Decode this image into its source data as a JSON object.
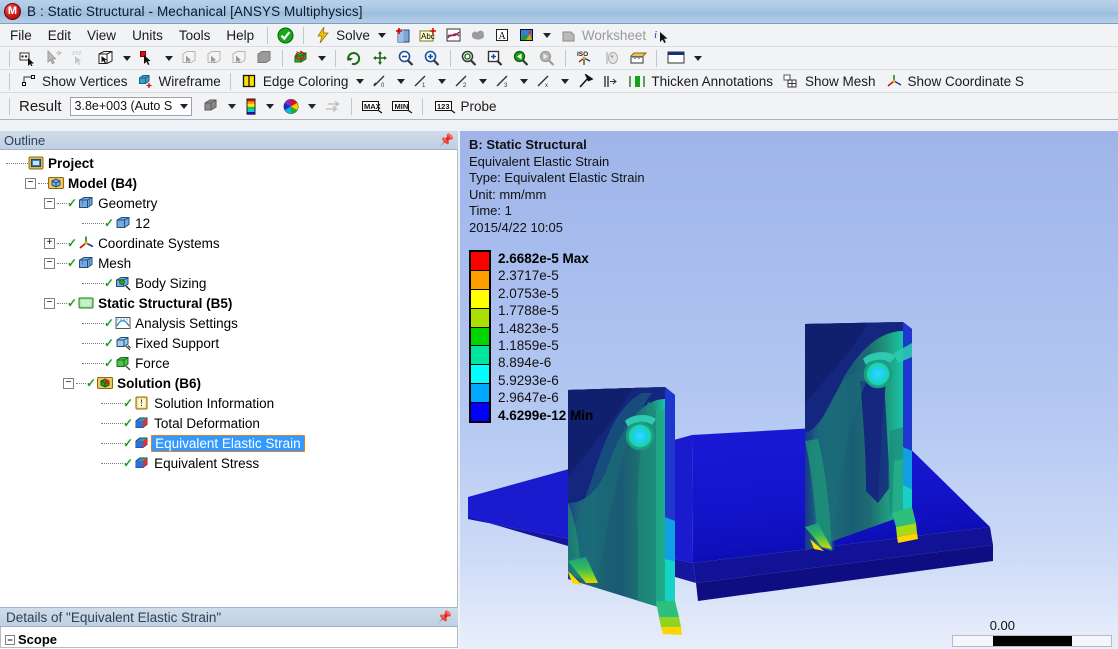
{
  "window": {
    "title": "B : Static Structural - Mechanical [ANSYS Multiphysics]",
    "logo_letter": "M"
  },
  "menubar": {
    "items": [
      "File",
      "Edit",
      "View",
      "Units",
      "Tools",
      "Help"
    ],
    "solve_label": "Solve",
    "worksheet_label": "Worksheet",
    "icons": [
      "green-check-icon",
      "lightning-solve-icon",
      "new-chart-icon",
      "abc-label-icon",
      "chart-curve-icon",
      "cloud-icon",
      "annotation-a-icon",
      "image-capture-icon",
      "worksheet-icon",
      "info-cursor-icon"
    ]
  },
  "toolbar_selection": {
    "icons": [
      "select-cursor-icon",
      "pointer-arrow-icon",
      "xyz-axis-icon",
      "box-select-icon",
      "cursor-red-icon",
      "vertex-select-icon",
      "edge-select-icon",
      "face-select-icon",
      "body-select-icon",
      "body-color-icon",
      "rotate-icon",
      "pan-icon",
      "zoom-out-icon",
      "zoom-in-icon",
      "zoom-to-fit-icon",
      "box-zoom-icon",
      "previous-view-icon",
      "next-view-icon",
      "iso-view-icon",
      "look-at-icon",
      "ruler-icon",
      "viewport-layout-icon"
    ]
  },
  "toolbar_display": {
    "show_vertices": "Show Vertices",
    "wireframe": "Wireframe",
    "edge_coloring": "Edge Coloring",
    "thicken_annotations": "Thicken Annotations",
    "show_mesh": "Show Mesh",
    "show_coordinate_systems": "Show Coordinate S",
    "edge_thickness_icons": [
      "edge-0-icon",
      "edge-1-icon",
      "edge-2-icon",
      "edge-3-icon",
      "edge-x-icon"
    ],
    "other_icons": [
      "random-colors-icon",
      "annotation-pin-icon",
      "vector-display-icon",
      "thicken-icon"
    ]
  },
  "toolbar_result": {
    "label": "Result",
    "scale_value": "3.8e+003 (Auto S",
    "probe_label": "Probe",
    "icons": [
      "geometry-display-icon",
      "contour-bands-icon",
      "color-scheme-icon",
      "vector-arrows-icon",
      "max-tag-icon",
      "min-tag-icon",
      "probe-123-icon"
    ]
  },
  "outline": {
    "header": "Outline",
    "pin_icon": "pin-icon",
    "items": [
      {
        "label": "Project",
        "indent": 0,
        "expander": "",
        "check": false,
        "bold": true,
        "icon": "project-icon",
        "selected": false
      },
      {
        "label": "Model (B4)",
        "indent": 1,
        "expander": "-",
        "check": false,
        "bold": true,
        "icon": "model-icon",
        "selected": false
      },
      {
        "label": "Geometry",
        "indent": 2,
        "expander": "-",
        "check": true,
        "bold": false,
        "icon": "geometry-icon",
        "selected": false
      },
      {
        "label": "12",
        "indent": 4,
        "expander": "",
        "check": true,
        "bold": false,
        "icon": "body-icon",
        "selected": false
      },
      {
        "label": "Coordinate Systems",
        "indent": 2,
        "expander": "+",
        "check": true,
        "bold": false,
        "icon": "coordsys-icon",
        "selected": false
      },
      {
        "label": "Mesh",
        "indent": 2,
        "expander": "-",
        "check": true,
        "bold": false,
        "icon": "mesh-icon",
        "selected": false
      },
      {
        "label": "Body Sizing",
        "indent": 4,
        "expander": "",
        "check": true,
        "bold": false,
        "icon": "body-sizing-icon",
        "selected": false
      },
      {
        "label": "Static Structural (B5)",
        "indent": 2,
        "expander": "-",
        "check": true,
        "bold": true,
        "icon": "analysis-icon",
        "selected": false
      },
      {
        "label": "Analysis Settings",
        "indent": 4,
        "expander": "",
        "check": true,
        "bold": false,
        "icon": "settings-icon",
        "selected": false
      },
      {
        "label": "Fixed Support",
        "indent": 4,
        "expander": "",
        "check": true,
        "bold": false,
        "icon": "fixed-support-icon",
        "selected": false
      },
      {
        "label": "Force",
        "indent": 4,
        "expander": "",
        "check": true,
        "bold": false,
        "icon": "force-icon",
        "selected": false
      },
      {
        "label": "Solution (B6)",
        "indent": 3,
        "expander": "-",
        "check": true,
        "bold": true,
        "icon": "solution-icon",
        "selected": false
      },
      {
        "label": "Solution Information",
        "indent": 5,
        "expander": "",
        "check": true,
        "bold": false,
        "icon": "solution-info-icon",
        "selected": false
      },
      {
        "label": "Total Deformation",
        "indent": 5,
        "expander": "",
        "check": true,
        "bold": false,
        "icon": "result-icon",
        "selected": false
      },
      {
        "label": "Equivalent Elastic Strain",
        "indent": 5,
        "expander": "",
        "check": true,
        "bold": false,
        "icon": "result-icon",
        "selected": true
      },
      {
        "label": "Equivalent Stress",
        "indent": 5,
        "expander": "",
        "check": true,
        "bold": false,
        "icon": "result-icon",
        "selected": false
      }
    ]
  },
  "details": {
    "header": "Details of \"Equivalent Elastic Strain\"",
    "pin_icon": "pin-icon",
    "first_row": "Scope"
  },
  "viewport": {
    "overlay_lines": [
      {
        "text": "B: Static Structural",
        "bold": true
      },
      {
        "text": "Equivalent Elastic Strain",
        "bold": false
      },
      {
        "text": "Type: Equivalent Elastic Strain",
        "bold": false
      },
      {
        "text": "Unit: mm/mm",
        "bold": false
      },
      {
        "text": "Time: 1",
        "bold": false
      },
      {
        "text": "2015/4/22 10:05",
        "bold": false
      }
    ],
    "scale_value": "0.00",
    "legend": {
      "entries": [
        {
          "label": "2.6682e-5 Max",
          "color": "#ff0000",
          "bold": true
        },
        {
          "label": "2.3717e-5",
          "color": "#ff9e00",
          "bold": false
        },
        {
          "label": "2.0753e-5",
          "color": "#ffff00",
          "bold": false
        },
        {
          "label": "1.7788e-5",
          "color": "#a8e000",
          "bold": false
        },
        {
          "label": "1.4823e-5",
          "color": "#00d400",
          "bold": false
        },
        {
          "label": "1.1859e-5",
          "color": "#00e5a0",
          "bold": false
        },
        {
          "label": "8.894e-6",
          "color": "#00ffff",
          "bold": false
        },
        {
          "label": "5.9293e-6",
          "color": "#00a8ff",
          "bold": false
        },
        {
          "label": "2.9647e-6",
          "color": "#0000ff",
          "bold": false
        },
        {
          "label": "4.6299e-12 Min",
          "color": null,
          "bold": true
        }
      ]
    }
  },
  "chart_data": {
    "type": "heatmap",
    "title": "Equivalent Elastic Strain contour plot",
    "unit": "mm/mm",
    "time": "1",
    "min": 4.6299e-12,
    "max": 2.6682e-05,
    "band_upper_bounds": [
      2.6682e-05,
      2.3717e-05,
      2.0753e-05,
      1.7788e-05,
      1.4823e-05,
      1.1859e-05,
      8.894e-06,
      5.9293e-06,
      2.9647e-06,
      4.6299e-12
    ],
    "band_colors": [
      "#ff0000",
      "#ff9e00",
      "#ffff00",
      "#a8e000",
      "#00d400",
      "#00e5a0",
      "#00ffff",
      "#00a8ff",
      "#0000ff"
    ],
    "legend_position": "left"
  }
}
